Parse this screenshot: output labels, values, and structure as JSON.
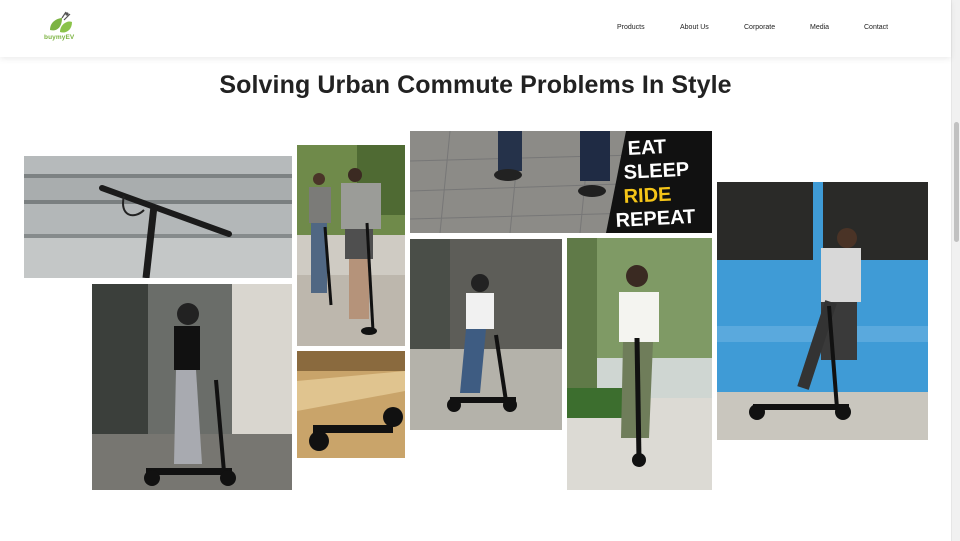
{
  "header": {
    "logo_text": "buymyEV",
    "nav": [
      {
        "label": "Products"
      },
      {
        "label": "About Us"
      },
      {
        "label": "Corporate"
      },
      {
        "label": "Media"
      },
      {
        "label": "Contact"
      }
    ]
  },
  "main": {
    "title": "Solving Urban Commute Problems In Style",
    "sticker_lines": [
      "EAT",
      "SLEEP",
      "RIDE",
      "REPEAT"
    ]
  },
  "colors": {
    "brand_green": "#7cb342",
    "title_text": "#222222",
    "wall_blue": "#3f9bd6"
  }
}
